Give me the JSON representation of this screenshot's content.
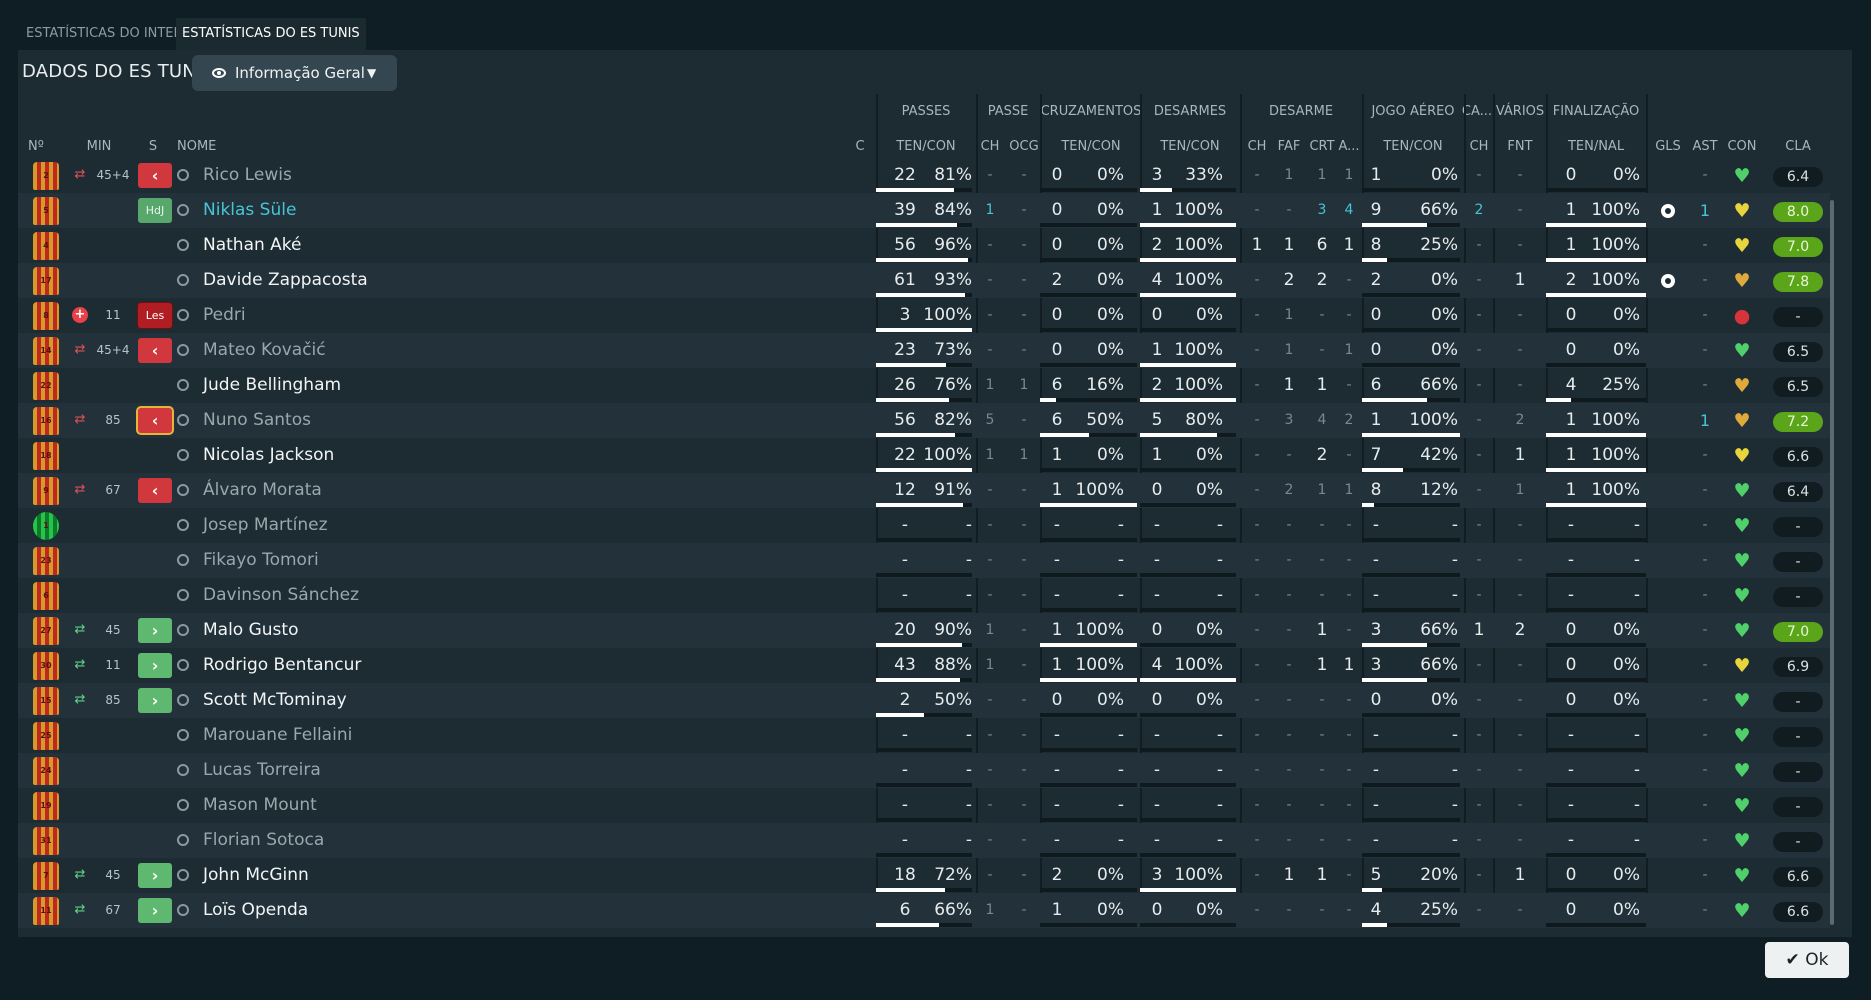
{
  "tabs": [
    {
      "label": "ESTATÍSTICAS DO INTER",
      "active": false
    },
    {
      "label": "ESTATÍSTICAS DO ES TUNIS",
      "active": true
    }
  ],
  "title": "DADOS DO ES TUNIS",
  "view_dropdown": {
    "label": "Informação Geral",
    "icon": "eye-icon"
  },
  "group_headers": [
    "PASSES",
    "PASSE",
    "CRUZAMENTOS",
    "DESARMES",
    "DESARME",
    "JOGO AÉREO",
    "CA...",
    "VÁRIOS",
    "FINALIZAÇÃO"
  ],
  "column_headers": [
    "Nº",
    "MIN",
    "S",
    "NOME",
    "C",
    "TEN/CON",
    "CH",
    "OCG",
    "TEN/CON",
    "TEN/CON",
    "CH",
    "FAF",
    "CRT",
    "A...",
    "TEN/CON",
    "CH",
    "FNT",
    "TEN/NAL",
    "GLS",
    "AST",
    "CON",
    "CLA"
  ],
  "players": [
    {
      "num": "2",
      "min": "45+4",
      "sub": "out",
      "btn": "red",
      "name": "Rico Lewis",
      "style": "faded",
      "pas": [
        "22",
        "81%"
      ],
      "pas_pct": 0.81,
      "ch1": "-",
      "ocg": "-",
      "cru": [
        "0",
        "0%"
      ],
      "cru_pct": 0,
      "des": [
        "3",
        "33%"
      ],
      "des_pct": 0.33,
      "dch": "-",
      "faf": "1",
      "crt": "1",
      "a": "1",
      "jog": [
        "1",
        "0%"
      ],
      "jog_pct": 0,
      "cach": "-",
      "fnt": "-",
      "fin": [
        "0",
        "0%"
      ],
      "fin_pct": 0,
      "gls": "",
      "ast": "-",
      "con": "green",
      "cla": "6.4",
      "good": false
    },
    {
      "num": "5",
      "min": "",
      "sub": "",
      "btn": "hdj",
      "btn_label": "HdJ",
      "name": "Niklas Süle",
      "style": "hl",
      "pas": [
        "39",
        "84%"
      ],
      "pas_pct": 0.84,
      "ch1": "1",
      "ocg": "-",
      "cru": [
        "0",
        "0%"
      ],
      "cru_pct": 0,
      "des": [
        "1",
        "100%"
      ],
      "des_pct": 1,
      "dch": "-",
      "faf": "-",
      "crt": "3",
      "a": "4",
      "jog": [
        "9",
        "66%"
      ],
      "jog_pct": 0.66,
      "cach": "2",
      "fnt": "-",
      "fin": [
        "1",
        "100%"
      ],
      "fin_pct": 1,
      "gls": "ball",
      "ast": "1",
      "con": "yellow",
      "cla": "8.0",
      "good": true
    },
    {
      "num": "4",
      "min": "",
      "sub": "",
      "btn": "",
      "name": "Nathan Aké",
      "style": "bright",
      "pas": [
        "56",
        "96%"
      ],
      "pas_pct": 0.96,
      "ch1": "-",
      "ocg": "-",
      "cru": [
        "0",
        "0%"
      ],
      "cru_pct": 0,
      "des": [
        "2",
        "100%"
      ],
      "des_pct": 1,
      "dch": "1",
      "faf": "1",
      "crt": "6",
      "a": "1",
      "jog": [
        "8",
        "25%"
      ],
      "jog_pct": 0.25,
      "cach": "-",
      "fnt": "-",
      "fin": [
        "1",
        "100%"
      ],
      "fin_pct": 1,
      "gls": "",
      "ast": "-",
      "con": "yellow",
      "cla": "7.0",
      "good": true
    },
    {
      "num": "17",
      "min": "",
      "sub": "",
      "btn": "",
      "name": "Davide Zappacosta",
      "style": "bright",
      "pas": [
        "61",
        "93%"
      ],
      "pas_pct": 0.93,
      "ch1": "-",
      "ocg": "-",
      "cru": [
        "2",
        "0%"
      ],
      "cru_pct": 0,
      "des": [
        "4",
        "100%"
      ],
      "des_pct": 1,
      "dch": "-",
      "faf": "2",
      "crt": "2",
      "a": "-",
      "jog": [
        "2",
        "0%"
      ],
      "jog_pct": 0,
      "cach": "-",
      "fnt": "1",
      "fin": [
        "2",
        "100%"
      ],
      "fin_pct": 1,
      "gls": "ball",
      "ast": "-",
      "con": "orange",
      "cla": "7.8",
      "good": true
    },
    {
      "num": "8",
      "min": "11",
      "sub": "injury",
      "btn": "les",
      "btn_label": "Les",
      "name": "Pedri",
      "style": "faded",
      "pas": [
        "3",
        "100%"
      ],
      "pas_pct": 1,
      "ch1": "-",
      "ocg": "-",
      "cru": [
        "0",
        "0%"
      ],
      "cru_pct": 0,
      "des": [
        "0",
        "0%"
      ],
      "des_pct": 0,
      "dch": "-",
      "faf": "1",
      "crt": "-",
      "a": "-",
      "jog": [
        "0",
        "0%"
      ],
      "jog_pct": 0,
      "cach": "-",
      "fnt": "-",
      "fin": [
        "0",
        "0%"
      ],
      "fin_pct": 0,
      "gls": "",
      "ast": "-",
      "con": "red",
      "cla": "-",
      "good": false
    },
    {
      "num": "14",
      "min": "45+4",
      "sub": "out",
      "btn": "red",
      "name": "Mateo Kovačić",
      "style": "faded",
      "pas": [
        "23",
        "73%"
      ],
      "pas_pct": 0.73,
      "ch1": "-",
      "ocg": "-",
      "cru": [
        "0",
        "0%"
      ],
      "cru_pct": 0,
      "des": [
        "1",
        "100%"
      ],
      "des_pct": 1,
      "dch": "-",
      "faf": "1",
      "crt": "-",
      "a": "1",
      "jog": [
        "0",
        "0%"
      ],
      "jog_pct": 0,
      "cach": "-",
      "fnt": "-",
      "fin": [
        "0",
        "0%"
      ],
      "fin_pct": 0,
      "gls": "",
      "ast": "-",
      "con": "green",
      "cla": "6.5",
      "good": false
    },
    {
      "num": "22",
      "min": "",
      "sub": "",
      "btn": "",
      "name": "Jude Bellingham",
      "style": "bright",
      "pas": [
        "26",
        "76%"
      ],
      "pas_pct": 0.76,
      "ch1": "1",
      "ocg": "1",
      "cru": [
        "6",
        "16%"
      ],
      "cru_pct": 0.16,
      "des": [
        "2",
        "100%"
      ],
      "des_pct": 1,
      "dch": "-",
      "faf": "1",
      "crt": "1",
      "a": "-",
      "jog": [
        "6",
        "66%"
      ],
      "jog_pct": 0.66,
      "cach": "-",
      "fnt": "-",
      "fin": [
        "4",
        "25%"
      ],
      "fin_pct": 0.25,
      "gls": "",
      "ast": "-",
      "con": "orange",
      "cla": "6.5",
      "good": false
    },
    {
      "num": "16",
      "min": "85",
      "sub": "out",
      "btn": "redhl",
      "name": "Nuno Santos",
      "style": "faded",
      "pas": [
        "56",
        "82%"
      ],
      "pas_pct": 0.82,
      "ch1": "5",
      "ocg": "-",
      "cru": [
        "6",
        "50%"
      ],
      "cru_pct": 0.5,
      "des": [
        "5",
        "80%"
      ],
      "des_pct": 0.8,
      "dch": "-",
      "faf": "3",
      "crt": "4",
      "a": "2",
      "jog": [
        "1",
        "100%"
      ],
      "jog_pct": 1,
      "cach": "-",
      "fnt": "2",
      "fin": [
        "1",
        "100%"
      ],
      "fin_pct": 1,
      "gls": "",
      "ast": "1",
      "con": "orange",
      "cla": "7.2",
      "good": true
    },
    {
      "num": "18",
      "min": "",
      "sub": "",
      "btn": "",
      "name": "Nicolas Jackson",
      "style": "bright",
      "pas": [
        "22",
        "100%"
      ],
      "pas_pct": 1,
      "ch1": "1",
      "ocg": "1",
      "cru": [
        "1",
        "0%"
      ],
      "cru_pct": 0,
      "des": [
        "1",
        "0%"
      ],
      "des_pct": 0,
      "dch": "-",
      "faf": "-",
      "crt": "2",
      "a": "-",
      "jog": [
        "7",
        "42%"
      ],
      "jog_pct": 0.42,
      "cach": "-",
      "fnt": "1",
      "fin": [
        "1",
        "100%"
      ],
      "fin_pct": 1,
      "gls": "",
      "ast": "-",
      "con": "yellow",
      "cla": "6.6",
      "good": false
    },
    {
      "num": "9",
      "min": "67",
      "sub": "out",
      "btn": "red",
      "name": "Álvaro Morata",
      "style": "faded",
      "pas": [
        "12",
        "91%"
      ],
      "pas_pct": 0.91,
      "ch1": "-",
      "ocg": "-",
      "cru": [
        "1",
        "100%"
      ],
      "cru_pct": 1,
      "des": [
        "0",
        "0%"
      ],
      "des_pct": 0,
      "dch": "-",
      "faf": "2",
      "crt": "1",
      "a": "1",
      "jog": [
        "8",
        "12%"
      ],
      "jog_pct": 0.12,
      "cach": "-",
      "fnt": "1",
      "fin": [
        "1",
        "100%"
      ],
      "fin_pct": 1,
      "gls": "",
      "ast": "-",
      "con": "green",
      "cla": "6.4",
      "good": false
    },
    {
      "num": "1",
      "gk": true,
      "min": "",
      "sub": "",
      "btn": "",
      "name": "Josep Martínez",
      "style": "faded",
      "pas": [
        "-",
        "-"
      ],
      "pas_pct": 0,
      "ch1": "-",
      "ocg": "-",
      "cru": [
        "-",
        "-"
      ],
      "cru_pct": 0,
      "des": [
        "-",
        "-"
      ],
      "des_pct": 0,
      "dch": "-",
      "faf": "-",
      "crt": "-",
      "a": "-",
      "jog": [
        "-",
        "-"
      ],
      "jog_pct": 0,
      "cach": "-",
      "fnt": "-",
      "fin": [
        "-",
        "-"
      ],
      "fin_pct": 0,
      "gls": "",
      "ast": "-",
      "con": "green",
      "cla": "-",
      "good": false
    },
    {
      "num": "23",
      "min": "",
      "sub": "",
      "btn": "",
      "name": "Fikayo Tomori",
      "style": "faded",
      "pas": [
        "-",
        "-"
      ],
      "pas_pct": 0,
      "ch1": "-",
      "ocg": "-",
      "cru": [
        "-",
        "-"
      ],
      "cru_pct": 0,
      "des": [
        "-",
        "-"
      ],
      "des_pct": 0,
      "dch": "-",
      "faf": "-",
      "crt": "-",
      "a": "-",
      "jog": [
        "-",
        "-"
      ],
      "jog_pct": 0,
      "cach": "-",
      "fnt": "-",
      "fin": [
        "-",
        "-"
      ],
      "fin_pct": 0,
      "gls": "",
      "ast": "-",
      "con": "green",
      "cla": "-",
      "good": false
    },
    {
      "num": "6",
      "min": "",
      "sub": "",
      "btn": "",
      "name": "Davinson Sánchez",
      "style": "faded",
      "pas": [
        "-",
        "-"
      ],
      "pas_pct": 0,
      "ch1": "-",
      "ocg": "-",
      "cru": [
        "-",
        "-"
      ],
      "cru_pct": 0,
      "des": [
        "-",
        "-"
      ],
      "des_pct": 0,
      "dch": "-",
      "faf": "-",
      "crt": "-",
      "a": "-",
      "jog": [
        "-",
        "-"
      ],
      "jog_pct": 0,
      "cach": "-",
      "fnt": "-",
      "fin": [
        "-",
        "-"
      ],
      "fin_pct": 0,
      "gls": "",
      "ast": "-",
      "con": "green",
      "cla": "-",
      "good": false
    },
    {
      "num": "27",
      "min": "45",
      "sub": "in",
      "btn": "green",
      "name": "Malo Gusto",
      "style": "bright",
      "pas": [
        "20",
        "90%"
      ],
      "pas_pct": 0.9,
      "ch1": "1",
      "ocg": "-",
      "cru": [
        "1",
        "100%"
      ],
      "cru_pct": 1,
      "des": [
        "0",
        "0%"
      ],
      "des_pct": 0,
      "dch": "-",
      "faf": "-",
      "crt": "1",
      "a": "-",
      "jog": [
        "3",
        "66%"
      ],
      "jog_pct": 0.66,
      "cach": "1",
      "fnt": "2",
      "fin": [
        "0",
        "0%"
      ],
      "fin_pct": 0,
      "gls": "",
      "ast": "-",
      "con": "green",
      "cla": "7.0",
      "good": true
    },
    {
      "num": "30",
      "min": "11",
      "sub": "in",
      "btn": "green",
      "name": "Rodrigo Bentancur",
      "style": "bright",
      "pas": [
        "43",
        "88%"
      ],
      "pas_pct": 0.88,
      "ch1": "1",
      "ocg": "-",
      "cru": [
        "1",
        "100%"
      ],
      "cru_pct": 1,
      "des": [
        "4",
        "100%"
      ],
      "des_pct": 1,
      "dch": "-",
      "faf": "-",
      "crt": "1",
      "a": "1",
      "jog": [
        "3",
        "66%"
      ],
      "jog_pct": 0.66,
      "cach": "-",
      "fnt": "-",
      "fin": [
        "0",
        "0%"
      ],
      "fin_pct": 0,
      "gls": "",
      "ast": "-",
      "con": "yellow",
      "cla": "6.9",
      "good": false
    },
    {
      "num": "15",
      "min": "85",
      "sub": "in",
      "btn": "green",
      "name": "Scott McTominay",
      "style": "bright",
      "pas": [
        "2",
        "50%"
      ],
      "pas_pct": 0.5,
      "ch1": "-",
      "ocg": "-",
      "cru": [
        "0",
        "0%"
      ],
      "cru_pct": 0,
      "des": [
        "0",
        "0%"
      ],
      "des_pct": 0,
      "dch": "-",
      "faf": "-",
      "crt": "-",
      "a": "-",
      "jog": [
        "0",
        "0%"
      ],
      "jog_pct": 0,
      "cach": "-",
      "fnt": "-",
      "fin": [
        "0",
        "0%"
      ],
      "fin_pct": 0,
      "gls": "",
      "ast": "-",
      "con": "green",
      "cla": "-",
      "good": false
    },
    {
      "num": "25",
      "min": "",
      "sub": "",
      "btn": "",
      "name": "Marouane Fellaini",
      "style": "faded",
      "pas": [
        "-",
        "-"
      ],
      "pas_pct": 0,
      "ch1": "-",
      "ocg": "-",
      "cru": [
        "-",
        "-"
      ],
      "cru_pct": 0,
      "des": [
        "-",
        "-"
      ],
      "des_pct": 0,
      "dch": "-",
      "faf": "-",
      "crt": "-",
      "a": "-",
      "jog": [
        "-",
        "-"
      ],
      "jog_pct": 0,
      "cach": "-",
      "fnt": "-",
      "fin": [
        "-",
        "-"
      ],
      "fin_pct": 0,
      "gls": "",
      "ast": "-",
      "con": "green",
      "cla": "-",
      "good": false
    },
    {
      "num": "24",
      "min": "",
      "sub": "",
      "btn": "",
      "name": "Lucas Torreira",
      "style": "faded",
      "pas": [
        "-",
        "-"
      ],
      "pas_pct": 0,
      "ch1": "-",
      "ocg": "-",
      "cru": [
        "-",
        "-"
      ],
      "cru_pct": 0,
      "des": [
        "-",
        "-"
      ],
      "des_pct": 0,
      "dch": "-",
      "faf": "-",
      "crt": "-",
      "a": "-",
      "jog": [
        "-",
        "-"
      ],
      "jog_pct": 0,
      "cach": "-",
      "fnt": "-",
      "fin": [
        "-",
        "-"
      ],
      "fin_pct": 0,
      "gls": "",
      "ast": "-",
      "con": "green",
      "cla": "-",
      "good": false
    },
    {
      "num": "19",
      "min": "",
      "sub": "",
      "btn": "",
      "name": "Mason Mount",
      "style": "faded",
      "pas": [
        "-",
        "-"
      ],
      "pas_pct": 0,
      "ch1": "-",
      "ocg": "-",
      "cru": [
        "-",
        "-"
      ],
      "cru_pct": 0,
      "des": [
        "-",
        "-"
      ],
      "des_pct": 0,
      "dch": "-",
      "faf": "-",
      "crt": "-",
      "a": "-",
      "jog": [
        "-",
        "-"
      ],
      "jog_pct": 0,
      "cach": "-",
      "fnt": "-",
      "fin": [
        "-",
        "-"
      ],
      "fin_pct": 0,
      "gls": "",
      "ast": "-",
      "con": "green",
      "cla": "-",
      "good": false
    },
    {
      "num": "31",
      "min": "",
      "sub": "",
      "btn": "",
      "name": "Florian Sotoca",
      "style": "faded",
      "pas": [
        "-",
        "-"
      ],
      "pas_pct": 0,
      "ch1": "-",
      "ocg": "-",
      "cru": [
        "-",
        "-"
      ],
      "cru_pct": 0,
      "des": [
        "-",
        "-"
      ],
      "des_pct": 0,
      "dch": "-",
      "faf": "-",
      "crt": "-",
      "a": "-",
      "jog": [
        "-",
        "-"
      ],
      "jog_pct": 0,
      "cach": "-",
      "fnt": "-",
      "fin": [
        "-",
        "-"
      ],
      "fin_pct": 0,
      "gls": "",
      "ast": "-",
      "con": "green",
      "cla": "-",
      "good": false
    },
    {
      "num": "7",
      "min": "45",
      "sub": "in",
      "btn": "green",
      "name": "John McGinn",
      "style": "bright",
      "pas": [
        "18",
        "72%"
      ],
      "pas_pct": 0.72,
      "ch1": "-",
      "ocg": "-",
      "cru": [
        "2",
        "0%"
      ],
      "cru_pct": 0,
      "des": [
        "3",
        "100%"
      ],
      "des_pct": 1,
      "dch": "-",
      "faf": "1",
      "crt": "1",
      "a": "-",
      "jog": [
        "5",
        "20%"
      ],
      "jog_pct": 0.2,
      "cach": "-",
      "fnt": "1",
      "fin": [
        "0",
        "0%"
      ],
      "fin_pct": 0,
      "gls": "",
      "ast": "-",
      "con": "green",
      "cla": "6.6",
      "good": false
    },
    {
      "num": "11",
      "min": "67",
      "sub": "in",
      "btn": "green",
      "name": "Loïs Openda",
      "style": "bright",
      "pas": [
        "6",
        "66%"
      ],
      "pas_pct": 0.66,
      "ch1": "1",
      "ocg": "-",
      "cru": [
        "1",
        "0%"
      ],
      "cru_pct": 0,
      "des": [
        "0",
        "0%"
      ],
      "des_pct": 0,
      "dch": "-",
      "faf": "-",
      "crt": "-",
      "a": "-",
      "jog": [
        "4",
        "25%"
      ],
      "jog_pct": 0.25,
      "cach": "-",
      "fnt": "-",
      "fin": [
        "0",
        "0%"
      ],
      "fin_pct": 0,
      "gls": "",
      "ast": "-",
      "con": "green",
      "cla": "6.6",
      "good": false
    }
  ],
  "ok_button": {
    "label": "Ok",
    "icon": "check-icon"
  },
  "colors": {
    "accent": "#48c4d5",
    "rating_good": "#5aa51a",
    "sub_out": "#d0383d",
    "sub_in": "#5fb86f"
  }
}
